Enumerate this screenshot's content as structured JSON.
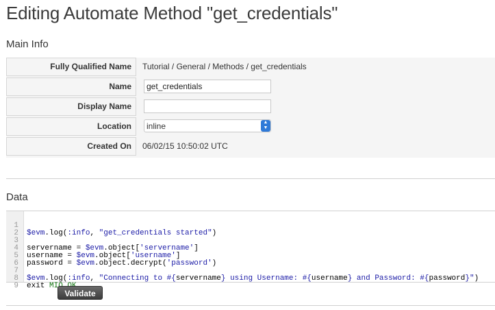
{
  "page": {
    "title": "Editing Automate Method \"get_credentials\""
  },
  "main_info": {
    "section_title": "Main Info",
    "rows": [
      {
        "label": "Fully Qualified Name",
        "value": "Tutorial / General / Methods / get_credentials"
      },
      {
        "label": "Name",
        "value": "get_credentials"
      },
      {
        "label": "Display Name",
        "value": ""
      },
      {
        "label": "Location",
        "value": "inline"
      },
      {
        "label": "Created On",
        "value": "06/02/15 10:50:02 UTC"
      }
    ]
  },
  "data_section": {
    "section_title": "Data",
    "code_lines": [
      {
        "no": "1"
      },
      {
        "no": "2"
      },
      {
        "no": "3"
      },
      {
        "no": "4"
      },
      {
        "no": "5"
      },
      {
        "no": "6"
      },
      {
        "no": "7"
      },
      {
        "no": "8"
      },
      {
        "no": "9"
      }
    ],
    "code": {
      "l1_a": "$evm",
      "l1_b": ".log(",
      "l1_c": ":info",
      "l1_d": ", ",
      "l1_e": "\"get_credentials started\"",
      "l1_f": ")",
      "l3_a": "servername = ",
      "l3_b": "$evm",
      "l3_c": ".object[",
      "l3_d": "'servername'",
      "l3_e": "]",
      "l4_a": "username = ",
      "l4_b": "$evm",
      "l4_c": ".object[",
      "l4_d": "'username'",
      "l4_e": "]",
      "l5_a": "password = ",
      "l5_b": "$evm",
      "l5_c": ".object.decrypt(",
      "l5_d": "'password'",
      "l5_e": ")",
      "l7_a": "$evm",
      "l7_b": ".log(",
      "l7_c": ":info",
      "l7_d": ", ",
      "l7_e": "\"Connecting to #{",
      "l7_f": "servername",
      "l7_g": "} using Username: #{",
      "l7_h": "username",
      "l7_i": "} and Password: #{",
      "l7_j": "password",
      "l7_k": "}\"",
      "l7_l": ")",
      "l8_a": "exit ",
      "l8_b": "MIQ_OK"
    },
    "validate_label": "Validate"
  },
  "colors": {
    "select_accent": "#2f7ad8",
    "code_string": "#1a1aa6",
    "code_constant": "#127612"
  }
}
